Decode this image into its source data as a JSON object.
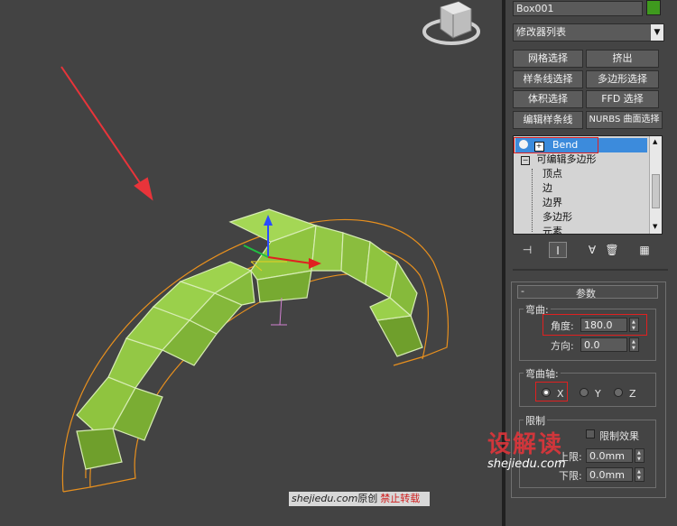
{
  "panel": {
    "object_name": "Box001",
    "modifier_list_label": "修改器列表",
    "buttons": [
      "网格选择",
      "挤出",
      "样条线选择",
      "多边形选择",
      "体积选择",
      "FFD 选择",
      "编辑样条线",
      "NURBS 曲面选择"
    ],
    "stack": {
      "top": "Bend",
      "base": "可编辑多边形",
      "subitems": [
        "顶点",
        "边",
        "边界",
        "多边形",
        "元素"
      ]
    },
    "params_title": "参数",
    "bend_group": "弯曲:",
    "angle_label": "角度:",
    "angle_value": "180.0",
    "direction_label": "方向:",
    "direction_value": "0.0",
    "axis_group": "弯曲轴:",
    "axes": [
      "X",
      "Y",
      "Z"
    ],
    "selected_axis": "X",
    "limit_group": "限制",
    "limit_effect_label": "限制效果",
    "upper_label": "上限:",
    "upper_value": "0.0mm",
    "lower_label": "下限:",
    "lower_value": "0.0mm"
  },
  "watermark": {
    "site": "shejiedu.com",
    "original": "原创",
    "no_repost": "禁止转载",
    "logo_text": "设解读",
    "logo_url": "shejiedu.com"
  },
  "colors": {
    "object_fill": "#8fc43f",
    "gizmo_orange": "#e8901e",
    "highlight_red": "#e02020",
    "selected_blue": "#3c8bdc"
  }
}
